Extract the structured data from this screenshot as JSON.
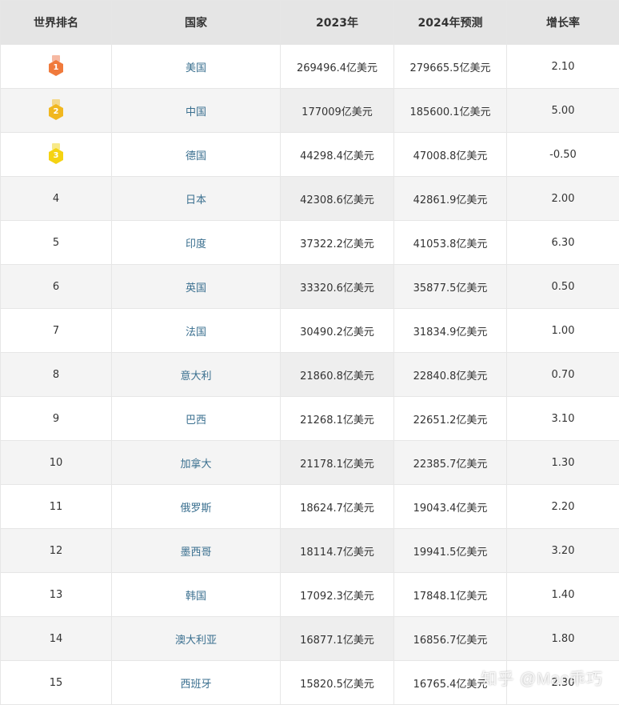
{
  "table": {
    "headers": {
      "rank": "世界排名",
      "country": "国家",
      "y2023": "2023年",
      "y2024": "2024年预测",
      "growth": "增长率"
    },
    "rows": [
      {
        "rank": "1",
        "country": "美国",
        "y2023": "269496.4亿美元",
        "y2024": "279665.5亿美元",
        "growth": "2.10"
      },
      {
        "rank": "2",
        "country": "中国",
        "y2023": "177009亿美元",
        "y2024": "185600.1亿美元",
        "growth": "5.00"
      },
      {
        "rank": "3",
        "country": "德国",
        "y2023": "44298.4亿美元",
        "y2024": "47008.8亿美元",
        "growth": "-0.50"
      },
      {
        "rank": "4",
        "country": "日本",
        "y2023": "42308.6亿美元",
        "y2024": "42861.9亿美元",
        "growth": "2.00"
      },
      {
        "rank": "5",
        "country": "印度",
        "y2023": "37322.2亿美元",
        "y2024": "41053.8亿美元",
        "growth": "6.30"
      },
      {
        "rank": "6",
        "country": "英国",
        "y2023": "33320.6亿美元",
        "y2024": "35877.5亿美元",
        "growth": "0.50"
      },
      {
        "rank": "7",
        "country": "法国",
        "y2023": "30490.2亿美元",
        "y2024": "31834.9亿美元",
        "growth": "1.00"
      },
      {
        "rank": "8",
        "country": "意大利",
        "y2023": "21860.8亿美元",
        "y2024": "22840.8亿美元",
        "growth": "0.70"
      },
      {
        "rank": "9",
        "country": "巴西",
        "y2023": "21268.1亿美元",
        "y2024": "22651.2亿美元",
        "growth": "3.10"
      },
      {
        "rank": "10",
        "country": "加拿大",
        "y2023": "21178.1亿美元",
        "y2024": "22385.7亿美元",
        "growth": "1.30"
      },
      {
        "rank": "11",
        "country": "俄罗斯",
        "y2023": "18624.7亿美元",
        "y2024": "19043.4亿美元",
        "growth": "2.20"
      },
      {
        "rank": "12",
        "country": "墨西哥",
        "y2023": "18114.7亿美元",
        "y2024": "19941.5亿美元",
        "growth": "3.20"
      },
      {
        "rank": "13",
        "country": "韩国",
        "y2023": "17092.3亿美元",
        "y2024": "17848.1亿美元",
        "growth": "1.40"
      },
      {
        "rank": "14",
        "country": "澳大利亚",
        "y2023": "16877.1亿美元",
        "y2024": "16856.7亿美元",
        "growth": "1.80"
      },
      {
        "rank": "15",
        "country": "西班牙",
        "y2023": "15820.5亿美元",
        "y2024": "16765.4亿美元",
        "growth": "2.30"
      }
    ]
  },
  "medals": {
    "rank1_color": "#f07a3c",
    "rank2_color": "#f1b71f",
    "rank3_color": "#f5d312"
  },
  "watermark": {
    "text": "知乎 @Mac乖巧"
  }
}
